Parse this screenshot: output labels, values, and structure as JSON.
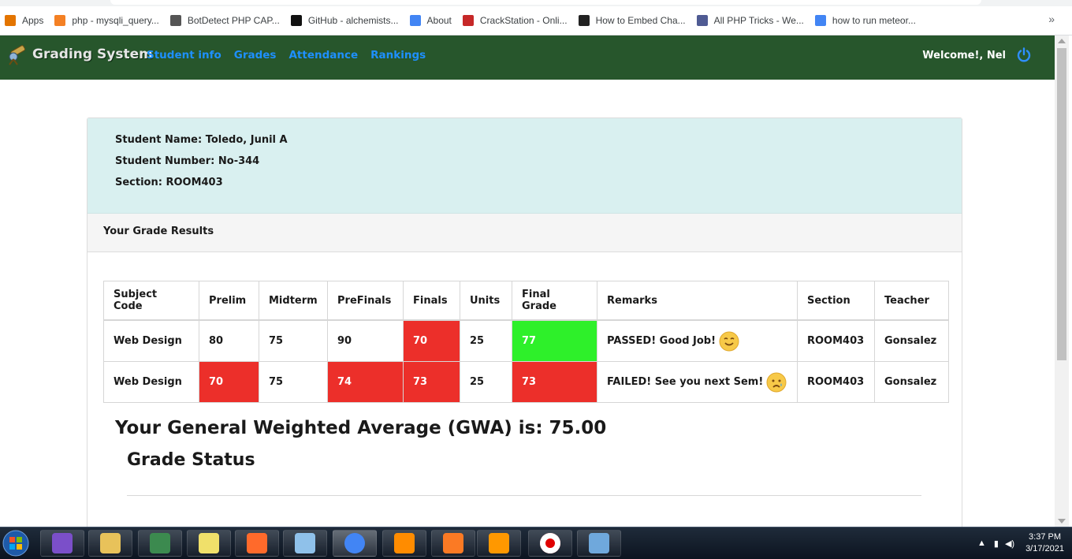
{
  "browser": {
    "bookmarks": [
      {
        "label": "Apps",
        "icon": "apps-grid-icon",
        "color": "#e37400"
      },
      {
        "label": "php - mysqli_query...",
        "icon": "stackoverflow-icon",
        "color": "#f48024"
      },
      {
        "label": "BotDetect PHP CAP...",
        "icon": "botdetect-icon",
        "color": "#555555"
      },
      {
        "label": "GitHub - alchemists...",
        "icon": "github-icon",
        "color": "#111111"
      },
      {
        "label": "About",
        "icon": "mdb-icon",
        "color": "#4285f4"
      },
      {
        "label": "CrackStation - Onli...",
        "icon": "crackstation-icon",
        "color": "#c62828"
      },
      {
        "label": "How to Embed Cha...",
        "icon": "embed-icon",
        "color": "#222222"
      },
      {
        "label": "All PHP Tricks - We...",
        "icon": "php-icon",
        "color": "#4f5b93"
      },
      {
        "label": "how to run meteor...",
        "icon": "google-icon",
        "color": "#4285f4"
      }
    ],
    "more_label": "»"
  },
  "navbar": {
    "brand": "Grading System",
    "links": [
      "Student info",
      "Grades",
      "Attendance",
      "Rankings"
    ],
    "welcome": "Welcome!, Nel",
    "power_icon": "power-icon",
    "bg_color": "#27562c",
    "link_color": "#1e90ff"
  },
  "student": {
    "name_label": "Student Name: Toledo, Junil A",
    "number_label": "Student Number: No-344",
    "section_label": "Section: ROOM403"
  },
  "results": {
    "heading": "Your Grade Results",
    "columns": [
      "Subject Code",
      "Prelim",
      "Midterm",
      "PreFinals",
      "Finals",
      "Units",
      "Final Grade",
      "Remarks",
      "Section",
      "Teacher"
    ],
    "rows": [
      {
        "subject": "Web Design",
        "prelim": "80",
        "midterm": "75",
        "prefinals": "90",
        "finals": "70",
        "units": "25",
        "final_grade": "77",
        "remarks": "PASSED! Good Job!",
        "remark_icon": "smiley-icon",
        "section": "ROOM403",
        "teacher": "Gonsalez"
      },
      {
        "subject": "Web Design",
        "prelim": "70",
        "midterm": "75",
        "prefinals": "74",
        "finals": "73",
        "units": "25",
        "final_grade": "73",
        "remarks": "FAILED! See you next Sem!",
        "remark_icon": "sad-face-icon",
        "section": "ROOM403",
        "teacher": "Gonsalez"
      }
    ],
    "fail_color": "#ec2f2a",
    "pass_color": "#2ef02a"
  },
  "gwa": {
    "text": "Your General Weighted Average (GWA) is: 75.00"
  },
  "grade_status": {
    "title": "Grade Status"
  },
  "taskbar": {
    "apps": [
      "visual-studio-icon",
      "file-explorer-icon",
      "git-icon",
      "sticky-notes-icon",
      "pencil-app-icon",
      "notepad-icon",
      "chrome-icon",
      "vlc-icon",
      "xampp-icon",
      "sublime-text-icon",
      "screen-recorder-icon",
      "paint-icon"
    ],
    "time": "3:37 PM",
    "date": "3/17/2021"
  }
}
